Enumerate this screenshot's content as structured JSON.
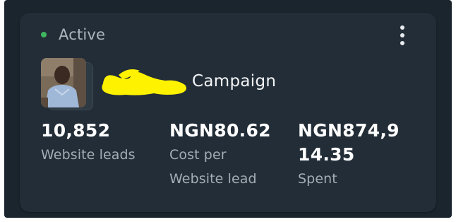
{
  "status": {
    "label": "Active",
    "color": "#3fb65f"
  },
  "menu": {
    "icon": "more-vertical-icon"
  },
  "campaign": {
    "name_suffix": "Campaign",
    "name_redaction_color": "#fff200"
  },
  "metrics": [
    {
      "value": "10,852",
      "label": "Website leads"
    },
    {
      "value": "NGN80.62",
      "label": "Cost per Website lead"
    },
    {
      "value": "NGN874,9 14.35",
      "label": "Spent"
    }
  ],
  "metric3_lines": {
    "value_line1": "NGN874,9",
    "value_line2": "14.35"
  },
  "metric2_lines": {
    "label_line1": "Cost per",
    "label_line2": "Website lead"
  }
}
